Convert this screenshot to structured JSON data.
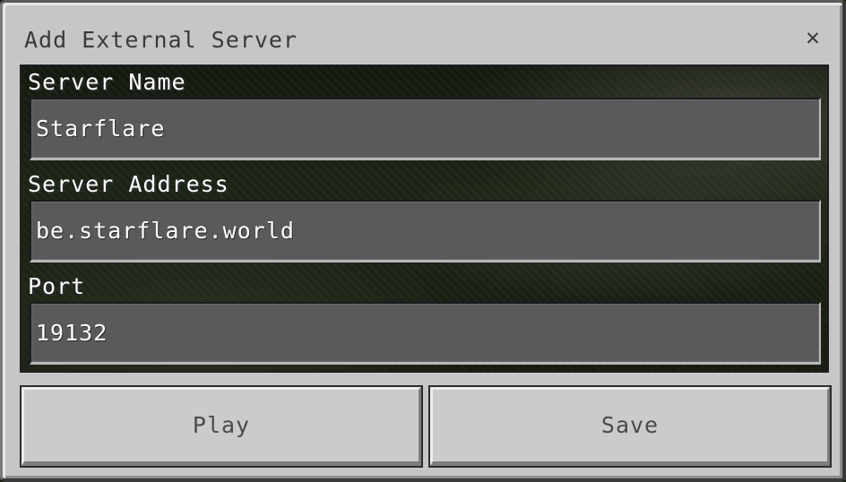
{
  "dialog": {
    "title": "Add External Server",
    "close_glyph": "✕"
  },
  "fields": {
    "server_name": {
      "label": "Server Name",
      "value": "Starflare"
    },
    "server_address": {
      "label": "Server Address",
      "value": "be.starflare.world"
    },
    "port": {
      "label": "Port",
      "value": "19132"
    }
  },
  "buttons": {
    "play_label": "Play",
    "save_label": "Save"
  },
  "colors": {
    "dialog_bg": "#c6c6c6",
    "input_bg": "#5a5a5a",
    "button_bg": "#cbcbcb",
    "label_text": "#ffffff"
  },
  "icons": {
    "close": "close-icon"
  }
}
